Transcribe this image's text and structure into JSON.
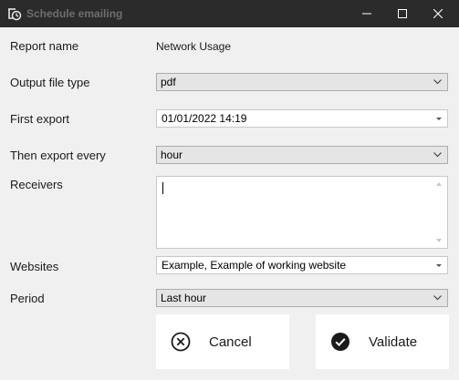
{
  "window": {
    "title": "Schedule emailing",
    "icon": "schedule-clock-icon",
    "controls": [
      "minimize-icon",
      "maximize-icon",
      "close-icon"
    ]
  },
  "form": {
    "report_name": {
      "label": "Report name",
      "value": "Network Usage"
    },
    "output_file_type": {
      "label": "Output file type",
      "value": "pdf"
    },
    "first_export": {
      "label": "First export",
      "value": "01/01/2022 14:19"
    },
    "then_export_every": {
      "label": "Then export every",
      "value": "hour"
    },
    "receivers": {
      "label": "Receivers",
      "value": ""
    },
    "websites": {
      "label": "Websites",
      "value": "Example, Example of working website"
    },
    "period": {
      "label": "Period",
      "value": "Last hour"
    }
  },
  "actions": {
    "cancel": {
      "label": "Cancel",
      "icon": "cancel-circle-x-icon"
    },
    "validate": {
      "label": "Validate",
      "icon": "check-circle-icon"
    }
  },
  "colors": {
    "titlebar": "#2b2b2b",
    "background": "#f0f0f0",
    "button_background": "#ffffff"
  }
}
